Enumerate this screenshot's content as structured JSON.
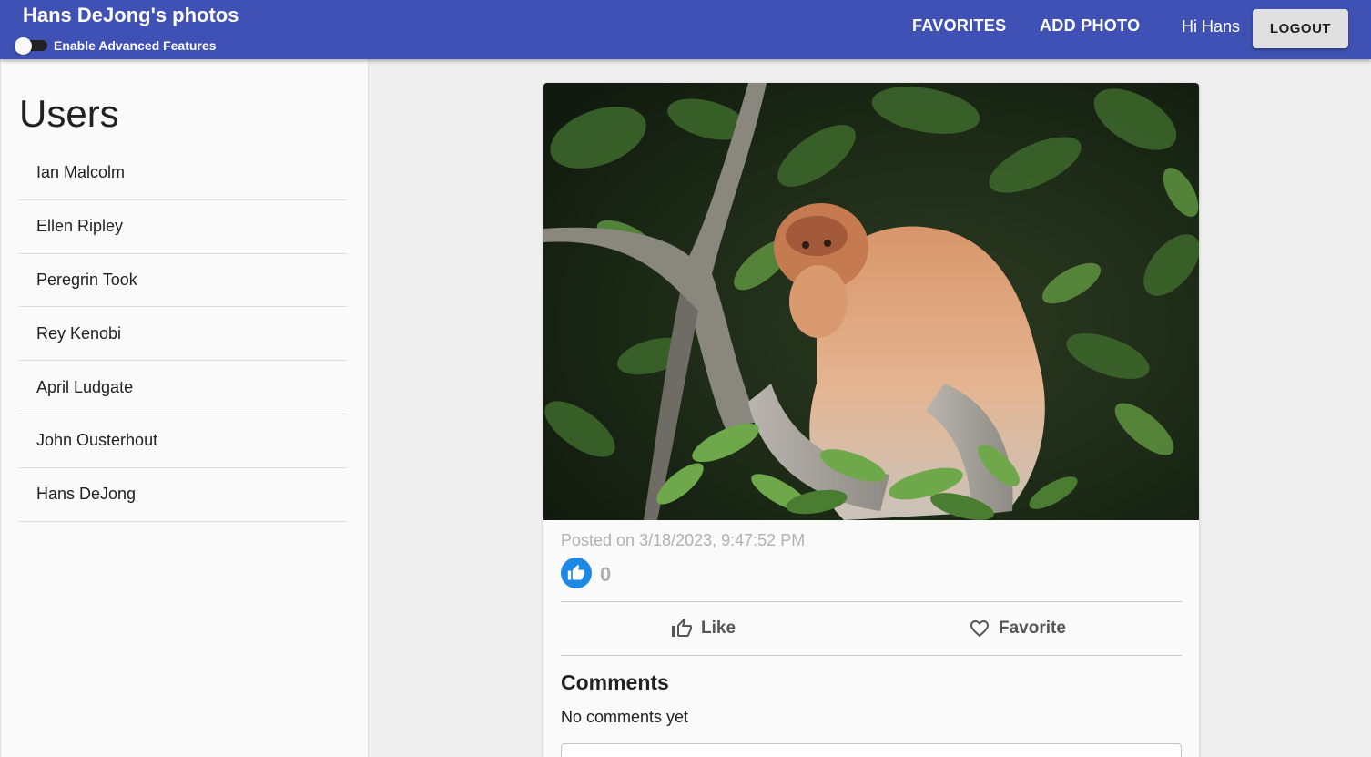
{
  "appbar": {
    "title": "Hans DeJong's photos",
    "toggle_label": "Enable Advanced Features",
    "favorites_label": "FAVORITES",
    "add_photo_label": "ADD PHOTO",
    "greeting": "Hi Hans",
    "logout_label": "LOGOUT",
    "accent_color": "#3f51b5"
  },
  "sidebar": {
    "title": "Users",
    "users": [
      {
        "name": "Ian Malcolm"
      },
      {
        "name": "Ellen Ripley"
      },
      {
        "name": "Peregrin Took"
      },
      {
        "name": "Rey Kenobi"
      },
      {
        "name": "April Ludgate"
      },
      {
        "name": "John Ousterhout"
      },
      {
        "name": "Hans DeJong"
      }
    ]
  },
  "photo": {
    "posted": "Posted on 3/18/2023, 9:47:52 PM",
    "like_count": "0",
    "like_label": "Like",
    "favorite_label": "Favorite",
    "comments_title": "Comments",
    "no_comments": "No comments yet",
    "like_badge_color": "#1e88e5"
  }
}
